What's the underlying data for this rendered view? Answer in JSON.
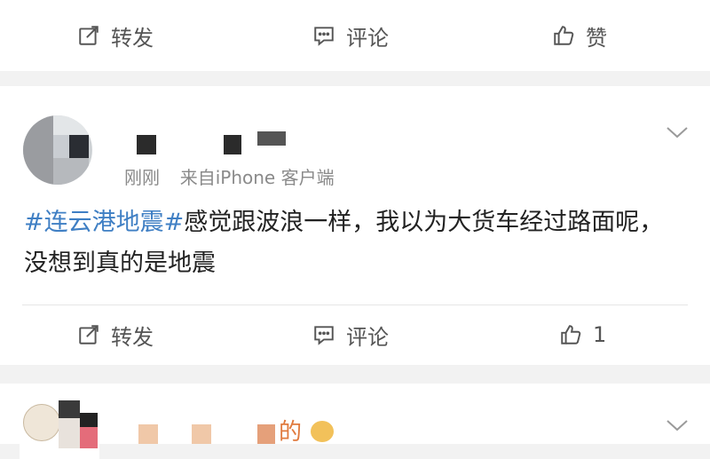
{
  "post_top": {
    "actions": {
      "repost": "转发",
      "comment": "评论",
      "like": "赞"
    }
  },
  "post_main": {
    "time": "刚刚",
    "source": "来自iPhone 客户端",
    "hashtag": "#连云港地震#",
    "text": "感觉跟波浪一样，我以为大货车经过路面呢，没想到真的是地震",
    "actions": {
      "repost": "转发",
      "comment": "评论",
      "like_count": "1"
    }
  },
  "post_next": {
    "name_suffix": "的"
  },
  "colors": {
    "link": "#3f7fc4",
    "text": "#222222",
    "muted": "#8a8a8a",
    "bg": "#f2f2f2"
  }
}
